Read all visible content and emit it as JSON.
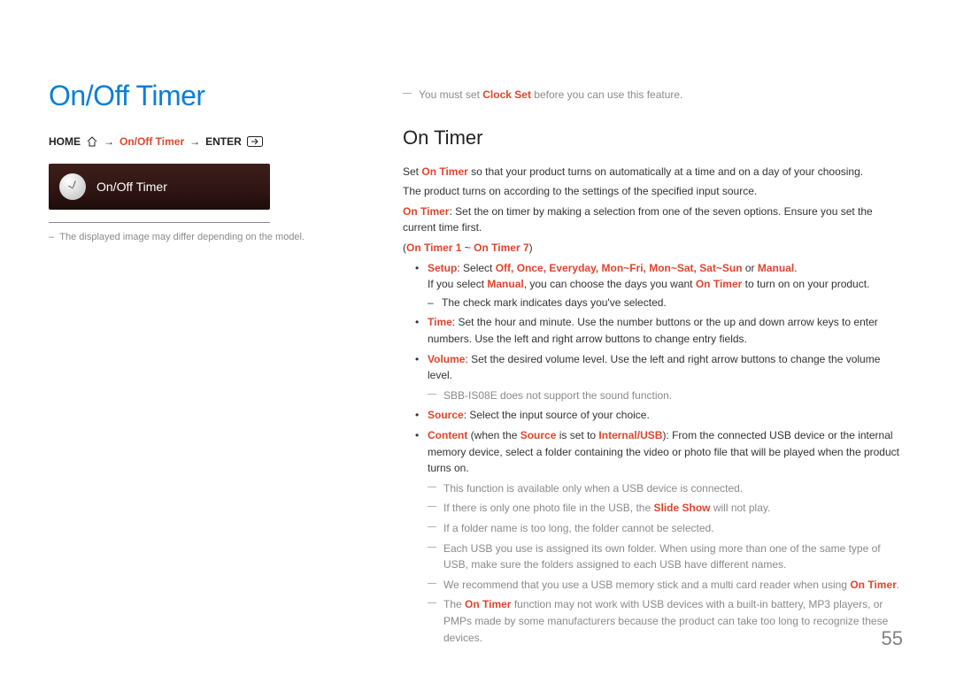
{
  "page_number": "55",
  "left": {
    "title": "On/Off Timer",
    "breadcrumb": {
      "home": "HOME",
      "timer": "On/Off Timer",
      "enter": "ENTER",
      "arrow": "→"
    },
    "menu_label": "On/Off Timer",
    "footnote_prefix": "–",
    "footnote": "The displayed image may differ depending on the model."
  },
  "right": {
    "topnote_a": "You must set ",
    "topnote_b": "Clock Set",
    "topnote_c": " before you can use this feature.",
    "heading": "On Timer",
    "p1_a": "Set ",
    "p1_b": "On Timer",
    "p1_c": " so that your product turns on automatically at a time and on a day of your choosing.",
    "p2": "The product turns on according to the settings of the specified input source.",
    "p3_a": "On Timer",
    "p3_b": ": Set the on timer by making a selection from one of the seven options. Ensure you set the current time first.",
    "range_open": "(",
    "range_a": "On Timer 1",
    "range_mid": " ~ ",
    "range_b": "On Timer 7",
    "range_close": ")",
    "setup_label": "Setup",
    "setup_sel": ": Select ",
    "setup_opts": "Off, Once, Everyday, Mon~Fri, Mon~Sat, Sat~Sun",
    "setup_or": " or ",
    "setup_manual": "Manual",
    "setup_end": ".",
    "setup_line2_a": "If you select ",
    "setup_line2_b": "Manual",
    "setup_line2_c": ", you can choose the days you want ",
    "setup_line2_d": "On Timer",
    "setup_line2_e": " to turn on on your product.",
    "setup_sub": "The check mark indicates days you've selected.",
    "time_label": "Time",
    "time_text": ": Set the hour and minute. Use the number buttons or the up and down arrow keys to enter numbers. Use the left and right arrow buttons to change entry fields.",
    "volume_label": "Volume",
    "volume_text": ": Set the desired volume level. Use the left and right arrow buttons to change the volume level.",
    "volume_note": "SBB-IS08E does not support the sound function.",
    "source_label": "Source",
    "source_text": ": Select the input source of your choice.",
    "content_label": "Content",
    "content_a": " (when the ",
    "content_b": "Source",
    "content_c": " is set to ",
    "content_d": "Internal/USB",
    "content_e": "): From the connected USB device or the internal memory device, select a folder containing the video or photo file that will be played when the product turns on.",
    "n1": "This function is available only when a USB device is connected.",
    "n2_a": "If there is only one photo file in the USB, the ",
    "n2_b": "Slide Show",
    "n2_c": " will not play.",
    "n3": "If a folder name is too long, the folder cannot be selected.",
    "n4": "Each USB you use is assigned its own folder. When using more than one of the same type of USB, make sure the folders assigned to each USB have different names.",
    "n5_a": "We recommend that you use a USB memory stick and a multi card reader when using ",
    "n5_b": "On Timer",
    "n5_c": ".",
    "n6_a": "The ",
    "n6_b": "On Timer",
    "n6_c": " function may not work with USB devices with a built-in battery, MP3 players, or PMPs made by some manufacturers because the product can take too long to recognize these devices."
  }
}
